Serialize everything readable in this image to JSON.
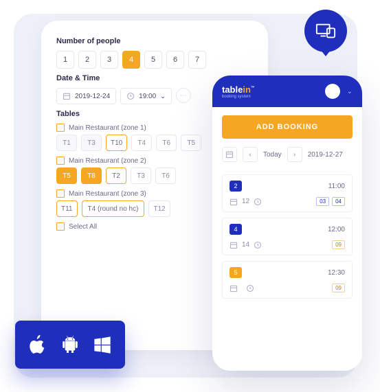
{
  "tablet": {
    "people_label": "Number of people",
    "people": [
      "1",
      "2",
      "3",
      "4",
      "5",
      "6",
      "7"
    ],
    "people_active": 3,
    "datetime_label": "Date & Time",
    "date": "2019-12-24",
    "time": "19:00",
    "tables_label": "Tables",
    "zones": [
      {
        "label": "Main Restaurant (zone 1)",
        "tables": [
          {
            "t": "T1",
            "s": ""
          },
          {
            "t": "T3",
            "s": ""
          },
          {
            "t": "T10",
            "s": "sel"
          },
          {
            "t": "T4",
            "s": "light"
          },
          {
            "t": "T6",
            "s": "light"
          },
          {
            "t": "T5",
            "s": "light"
          }
        ]
      },
      {
        "label": "Main Restaurant (zone 2)",
        "tables": [
          {
            "t": "T5",
            "s": "on"
          },
          {
            "t": "T8",
            "s": "on"
          },
          {
            "t": "T2",
            "s": "sel"
          },
          {
            "t": "T3",
            "s": "light"
          },
          {
            "t": "T6",
            "s": "light"
          }
        ]
      },
      {
        "label": "Main Restaurant (zone 3)",
        "tables": [
          {
            "t": "T11",
            "s": "sel"
          },
          {
            "t": "T4 (round no hc)",
            "s": "sel wide"
          },
          {
            "t": "T12",
            "s": "light"
          }
        ]
      }
    ],
    "select_all": "Select All"
  },
  "phone": {
    "brand_a": "table",
    "brand_b": "in",
    "brand_sub": "booking system",
    "add_booking": "ADD BOOKING",
    "today": "Today",
    "date": "2019-12-27",
    "bookings": [
      {
        "num": "2",
        "num_style": "",
        "time": "11:00",
        "count": "12",
        "tags": [
          "03",
          "04"
        ],
        "tag_style": ""
      },
      {
        "num": "4",
        "num_style": "",
        "time": "12:00",
        "count": "14",
        "tags": [
          "09"
        ],
        "tag_style": "amber"
      },
      {
        "num": "5",
        "num_style": "amber",
        "time": "12:30",
        "count": "",
        "tags": [
          "09"
        ],
        "tag_style": "amber"
      }
    ]
  }
}
